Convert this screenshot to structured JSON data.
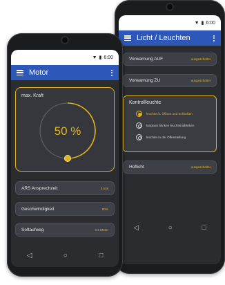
{
  "colors": {
    "accent": "#e2b41c",
    "appbar": "#2d57b8",
    "screen_bg": "#2a2c30",
    "row_bg": "#3d4046"
  },
  "phone_back": {
    "status": {
      "time": "6:00"
    },
    "appbar": {
      "title": "Licht / Leuchten"
    },
    "rows_top": [
      {
        "label": "Vorwarnung AUF",
        "value": "ausgeschaltet"
      },
      {
        "label": "Vorwarnung ZU",
        "value": "ausgeschaltet"
      }
    ],
    "kontrolle": {
      "title": "Kontrollleuchte",
      "options": [
        {
          "label": "leuchtet b. Öffnen und Schließen",
          "selected": true
        },
        {
          "label": "langsam blinken leuchten&blinken",
          "selected": false
        },
        {
          "label": "leuchtet in der Offenstellung",
          "selected": false
        }
      ]
    },
    "rows_bottom": [
      {
        "label": "Hoflicht",
        "value": "ausgeschaltet"
      }
    ]
  },
  "phone_front": {
    "status": {
      "time": "6:00"
    },
    "appbar": {
      "title": "Motor"
    },
    "kraft": {
      "label": "max. Kraft",
      "value_text": "50 %",
      "value": 50
    },
    "rows": [
      {
        "label": "ARS Ansprechzeit",
        "value": "0.50s"
      },
      {
        "label": "Geschwindigkeit",
        "value": "90%"
      },
      {
        "label": "Softaufweg",
        "value": "0.5 Meter"
      }
    ]
  },
  "icons": {
    "menu": "hamburger-icon",
    "more": "kebab-icon",
    "back": "back-triangle-icon",
    "home": "home-circle-icon",
    "recent": "recent-square-icon"
  }
}
